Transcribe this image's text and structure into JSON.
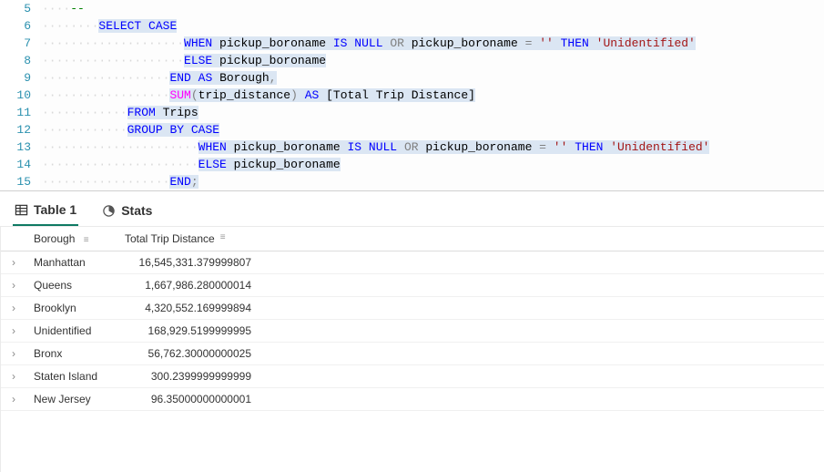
{
  "code_lines": [
    {
      "num": "5",
      "indent": 4,
      "segments": [
        {
          "t": "--",
          "cls": "cmt"
        }
      ]
    },
    {
      "num": "6",
      "indent": 8,
      "segments": [
        {
          "t": "SELECT",
          "cls": "kw sel"
        },
        {
          "t": " ",
          "cls": "sel"
        },
        {
          "t": "CASE",
          "cls": "kw sel"
        }
      ]
    },
    {
      "num": "7",
      "indent": 20,
      "segments": [
        {
          "t": "WHEN",
          "cls": "kw sel"
        },
        {
          "t": " pickup_boroname ",
          "cls": "black sel"
        },
        {
          "t": "IS",
          "cls": "kw sel"
        },
        {
          "t": " ",
          "cls": "sel"
        },
        {
          "t": "NULL",
          "cls": "kw sel"
        },
        {
          "t": " ",
          "cls": "sel"
        },
        {
          "t": "OR",
          "cls": "op sel"
        },
        {
          "t": " pickup_boroname ",
          "cls": "black sel"
        },
        {
          "t": "=",
          "cls": "op sel"
        },
        {
          "t": " ",
          "cls": "sel"
        },
        {
          "t": "''",
          "cls": "str sel"
        },
        {
          "t": " ",
          "cls": "sel"
        },
        {
          "t": "THEN",
          "cls": "kw sel"
        },
        {
          "t": " ",
          "cls": "sel"
        },
        {
          "t": "'Unidentified'",
          "cls": "str sel"
        }
      ]
    },
    {
      "num": "8",
      "indent": 20,
      "segments": [
        {
          "t": "ELSE",
          "cls": "kw sel"
        },
        {
          "t": " pickup_boroname",
          "cls": "black sel"
        }
      ]
    },
    {
      "num": "9",
      "indent": 18,
      "segments": [
        {
          "t": "END",
          "cls": "kw sel"
        },
        {
          "t": " ",
          "cls": "sel"
        },
        {
          "t": "AS",
          "cls": "kw sel"
        },
        {
          "t": " Borough",
          "cls": "black sel"
        },
        {
          "t": ",",
          "cls": "op sel"
        }
      ]
    },
    {
      "num": "10",
      "indent": 18,
      "segments": [
        {
          "t": "SUM",
          "cls": "func sel"
        },
        {
          "t": "(",
          "cls": "op sel"
        },
        {
          "t": "trip_distance",
          "cls": "black sel"
        },
        {
          "t": ")",
          "cls": "op sel"
        },
        {
          "t": " ",
          "cls": "sel"
        },
        {
          "t": "AS",
          "cls": "kw sel"
        },
        {
          "t": " ",
          "cls": "sel"
        },
        {
          "t": "[Total Trip Distance]",
          "cls": "black sel"
        }
      ]
    },
    {
      "num": "11",
      "indent": 12,
      "segments": [
        {
          "t": "FROM",
          "cls": "kw sel"
        },
        {
          "t": " Trips",
          "cls": "black sel"
        }
      ]
    },
    {
      "num": "12",
      "indent": 12,
      "segments": [
        {
          "t": "GROUP",
          "cls": "kw sel"
        },
        {
          "t": " ",
          "cls": "sel"
        },
        {
          "t": "BY",
          "cls": "kw sel"
        },
        {
          "t": " ",
          "cls": "sel"
        },
        {
          "t": "CASE",
          "cls": "kw sel"
        }
      ]
    },
    {
      "num": "13",
      "indent": 22,
      "segments": [
        {
          "t": "WHEN",
          "cls": "kw sel"
        },
        {
          "t": " pickup_boroname ",
          "cls": "black sel"
        },
        {
          "t": "IS",
          "cls": "kw sel"
        },
        {
          "t": " ",
          "cls": "sel"
        },
        {
          "t": "NULL",
          "cls": "kw sel"
        },
        {
          "t": " ",
          "cls": "sel"
        },
        {
          "t": "OR",
          "cls": "op sel"
        },
        {
          "t": " pickup_boroname ",
          "cls": "black sel"
        },
        {
          "t": "=",
          "cls": "op sel"
        },
        {
          "t": " ",
          "cls": "sel"
        },
        {
          "t": "''",
          "cls": "str sel"
        },
        {
          "t": " ",
          "cls": "sel"
        },
        {
          "t": "THEN",
          "cls": "kw sel"
        },
        {
          "t": " ",
          "cls": "sel"
        },
        {
          "t": "'Unidentified'",
          "cls": "str sel"
        }
      ]
    },
    {
      "num": "14",
      "indent": 22,
      "segments": [
        {
          "t": "ELSE",
          "cls": "kw sel"
        },
        {
          "t": " pickup_boroname",
          "cls": "black sel"
        }
      ]
    },
    {
      "num": "15",
      "indent": 18,
      "segments": [
        {
          "t": "END",
          "cls": "kw sel"
        },
        {
          "t": ";",
          "cls": "op sel"
        }
      ]
    }
  ],
  "tabs": {
    "table1": "Table 1",
    "stats": "Stats"
  },
  "columns": {
    "borough": "Borough",
    "distance": "Total Trip Distance"
  },
  "rows": [
    {
      "borough": "Manhattan",
      "distance": "16,545,331.379999807"
    },
    {
      "borough": "Queens",
      "distance": "1,667,986.280000014"
    },
    {
      "borough": "Brooklyn",
      "distance": "4,320,552.169999894"
    },
    {
      "borough": "Unidentified",
      "distance": "168,929.5199999995"
    },
    {
      "borough": "Bronx",
      "distance": "56,762.30000000025"
    },
    {
      "borough": "Staten Island",
      "distance": "300.2399999999999"
    },
    {
      "borough": "New Jersey",
      "distance": "96.35000000000001"
    }
  ],
  "chart_data": {
    "type": "table",
    "columns": [
      "Borough",
      "Total Trip Distance"
    ],
    "rows": [
      [
        "Manhattan",
        16545331.379999807
      ],
      [
        "Queens",
        1667986.280000014
      ],
      [
        "Brooklyn",
        4320552.169999894
      ],
      [
        "Unidentified",
        168929.5199999995
      ],
      [
        "Bronx",
        56762.30000000025
      ],
      [
        "Staten Island",
        300.2399999999999
      ],
      [
        "New Jersey",
        96.35000000000001
      ]
    ]
  }
}
